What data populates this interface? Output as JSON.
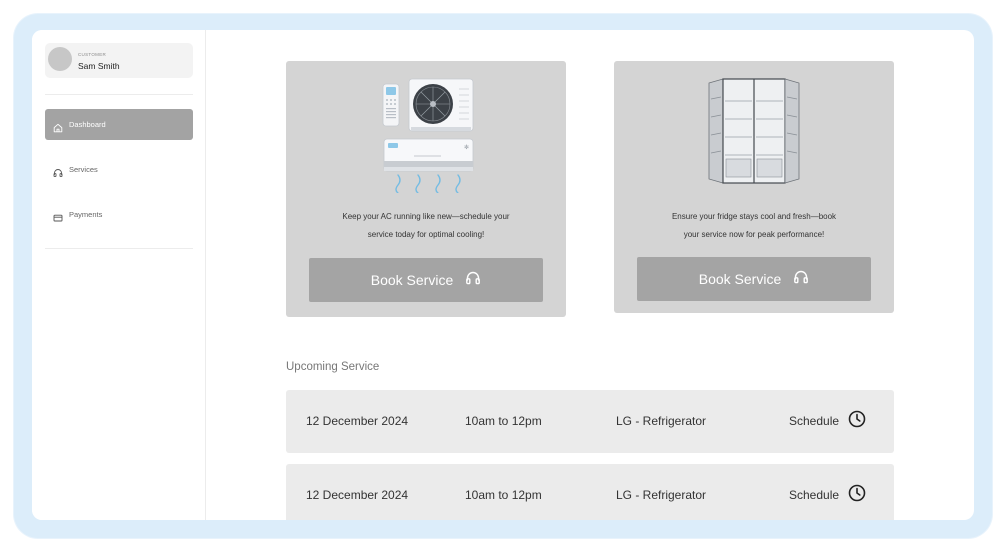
{
  "user": {
    "role": "CUSTOMER",
    "name": "Sam Smith"
  },
  "nav": [
    {
      "label": "Dashboard",
      "icon": "home-icon",
      "active": true
    },
    {
      "label": "Services",
      "icon": "headphones-icon",
      "active": false
    },
    {
      "label": "Payments",
      "icon": "card-icon",
      "active": false
    }
  ],
  "cards": [
    {
      "image": "air-conditioner-illustration",
      "line1": "Keep your AC running like new—schedule your",
      "line2": "service today for optimal cooling!",
      "button": "Book Service",
      "button_icon": "headphones-icon"
    },
    {
      "image": "refrigerator-illustration",
      "line1": "Ensure your fridge stays cool and fresh—book",
      "line2": "your service now for peak performance!",
      "button": "Book Service",
      "button_icon": "headphones-icon"
    }
  ],
  "upcoming": {
    "title": "Upcoming Service",
    "rows": [
      {
        "date": "12 December 2024",
        "time": "10am to 12pm",
        "appliance": "LG - Refrigerator",
        "action": "Schedule",
        "icon": "clock-icon"
      },
      {
        "date": "12 December 2024",
        "time": "10am to 12pm",
        "appliance": "LG - Refrigerator",
        "action": "Schedule",
        "icon": "clock-icon"
      }
    ]
  },
  "colors": {
    "frame": "#dcedfa",
    "card": "#d4d4d4",
    "button": "#a4a4a4",
    "row": "#ebebeb",
    "active_nav": "#a3a3a3"
  }
}
